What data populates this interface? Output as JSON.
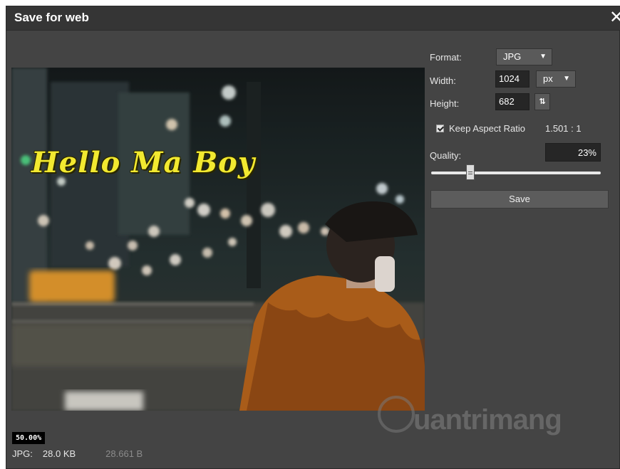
{
  "window": {
    "title": "Save for web",
    "close_icon": "close-icon"
  },
  "preview": {
    "overlay_text": "Hello Ma Boy",
    "zoom": "50.00%",
    "file_format": "JPG:",
    "file_size": "28.0 KB",
    "file_bytes": "28.661 B"
  },
  "options": {
    "format_label": "Format:",
    "format_value": "JPG",
    "width_label": "Width:",
    "width_value": "1024",
    "unit_value": "px",
    "height_label": "Height:",
    "height_value": "682",
    "swap_icon": "swap-dimensions-icon",
    "keep_aspect_label": "Keep Aspect Ratio",
    "keep_aspect_checked": true,
    "aspect_ratio": "1.501 : 1",
    "quality_label": "Quality:",
    "quality_value": "23%",
    "quality_fraction": 0.23,
    "save_label": "Save"
  },
  "watermark": {
    "text": "uantrimang"
  },
  "colors": {
    "dialog_bg": "#444444",
    "titlebar_bg": "#353535",
    "overlay_text": "#f2e930"
  }
}
